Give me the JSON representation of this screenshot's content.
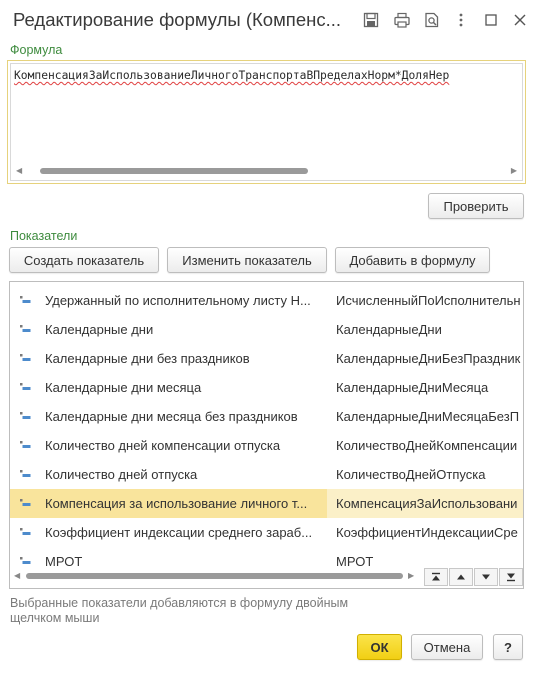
{
  "window": {
    "title": "Редактирование формулы (Компенс...",
    "toolbar_icons": [
      "save-icon",
      "print-icon",
      "preview-icon",
      "more-icon",
      "maximize-icon",
      "close-icon"
    ]
  },
  "formula": {
    "label": "Формула",
    "text": "КомпенсацияЗаИспользованиеЛичногоТранспортаВПределахНорм*ДоляНер",
    "check_button": "Проверить"
  },
  "indicators": {
    "label": "Показатели",
    "buttons": {
      "create": "Создать показатель",
      "edit": "Изменить показатель",
      "add": "Добавить в формулу"
    },
    "rows": [
      {
        "name": "Удержанный по исполнительному листу Н...",
        "id": "ИсчисленныйПоИсполнительн",
        "selected": false
      },
      {
        "name": "Календарные дни",
        "id": "КалендарныеДни",
        "selected": false
      },
      {
        "name": "Календарные дни без праздников",
        "id": "КалендарныеДниБезПраздник",
        "selected": false
      },
      {
        "name": "Календарные дни месяца",
        "id": "КалендарныеДниМесяца",
        "selected": false
      },
      {
        "name": "Календарные дни месяца без праздников",
        "id": "КалендарныеДниМесяцаБезП",
        "selected": false
      },
      {
        "name": "Количество дней компенсации отпуска",
        "id": "КоличествоДнейКомпенсации",
        "selected": false
      },
      {
        "name": "Количество дней отпуска",
        "id": "КоличествоДнейОтпуска",
        "selected": false
      },
      {
        "name": "Компенсация за использование личного т...",
        "id": "КомпенсацияЗаИспользовани",
        "selected": true
      },
      {
        "name": "Коэффициент индексации среднего зараб...",
        "id": "КоэффициентИндексацииСре",
        "selected": false
      },
      {
        "name": "МРОТ",
        "id": "МРОТ",
        "selected": false
      }
    ],
    "hint": "Выбранные показатели добавляются в формулу двойным щелчком мыши"
  },
  "footer": {
    "ok": "ОК",
    "cancel": "Отмена",
    "help": "?"
  },
  "colors": {
    "section_label": "#3e8b3e",
    "ok_button": "#f1cf14",
    "selected_row": "#f9e49c",
    "formula_border": "#e6d27c"
  }
}
